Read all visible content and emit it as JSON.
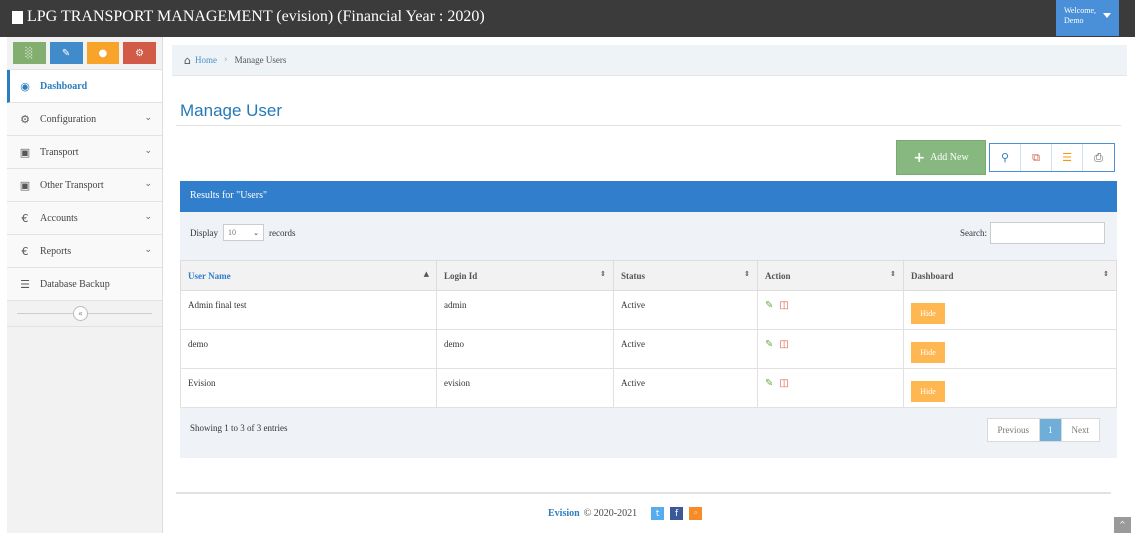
{
  "header": {
    "title": "LPG TRANSPORT MANAGEMENT (evision) (Financial Year : 2020)",
    "welcome_label": "Welcome,",
    "user": "Demo"
  },
  "sidebar": {
    "shortcuts": [
      {
        "icon": "bar-chart-icon",
        "color": "#82af6f"
      },
      {
        "icon": "pencil-icon",
        "color": "#428bca"
      },
      {
        "icon": "users-icon",
        "color": "#f8a42b"
      },
      {
        "icon": "cogs-icon",
        "color": "#d15b47"
      }
    ],
    "items": [
      {
        "label": "Dashboard",
        "icon": "dashboard-icon",
        "active": true
      },
      {
        "label": "Configuration",
        "icon": "cogs-icon"
      },
      {
        "label": "Transport",
        "icon": "cart-icon"
      },
      {
        "label": "Other Transport",
        "icon": "cart-icon"
      },
      {
        "label": "Accounts",
        "icon": "euro-icon"
      },
      {
        "label": "Reports",
        "icon": "euro-icon"
      },
      {
        "label": "Database Backup",
        "icon": "database-icon"
      }
    ]
  },
  "breadcrumb": {
    "home": "Home",
    "current": "Manage Users"
  },
  "page": {
    "title": "Manage User"
  },
  "toolbar": {
    "add_new": "Add New"
  },
  "results": {
    "heading": "Results for \"Users\""
  },
  "controls": {
    "display_label": "Display",
    "page_size": "10",
    "records_label": "records",
    "search_label": "Search:",
    "search_value": ""
  },
  "table": {
    "columns": [
      "User Name",
      "Login Id",
      "Status",
      "Action",
      "Dashboard"
    ],
    "rows": [
      {
        "user_name": "Admin final test",
        "login_id": "admin",
        "status": "Active",
        "dashboard_btn": "Hide"
      },
      {
        "user_name": "demo",
        "login_id": "demo",
        "status": "Active",
        "dashboard_btn": "Hide"
      },
      {
        "user_name": "Evision",
        "login_id": "evision",
        "status": "Active",
        "dashboard_btn": "Hide"
      }
    ]
  },
  "pagination": {
    "info": "Showing 1 to 3 of 3 entries",
    "previous": "Previous",
    "current": "1",
    "next": "Next"
  },
  "footer": {
    "brand": "Evision",
    "copyright": "© 2020-2021"
  },
  "colors": {
    "accent": "#307ecc",
    "topbar": "#3b3b3b",
    "add_button": "#87b87f",
    "hide_button": "#ffb752"
  }
}
